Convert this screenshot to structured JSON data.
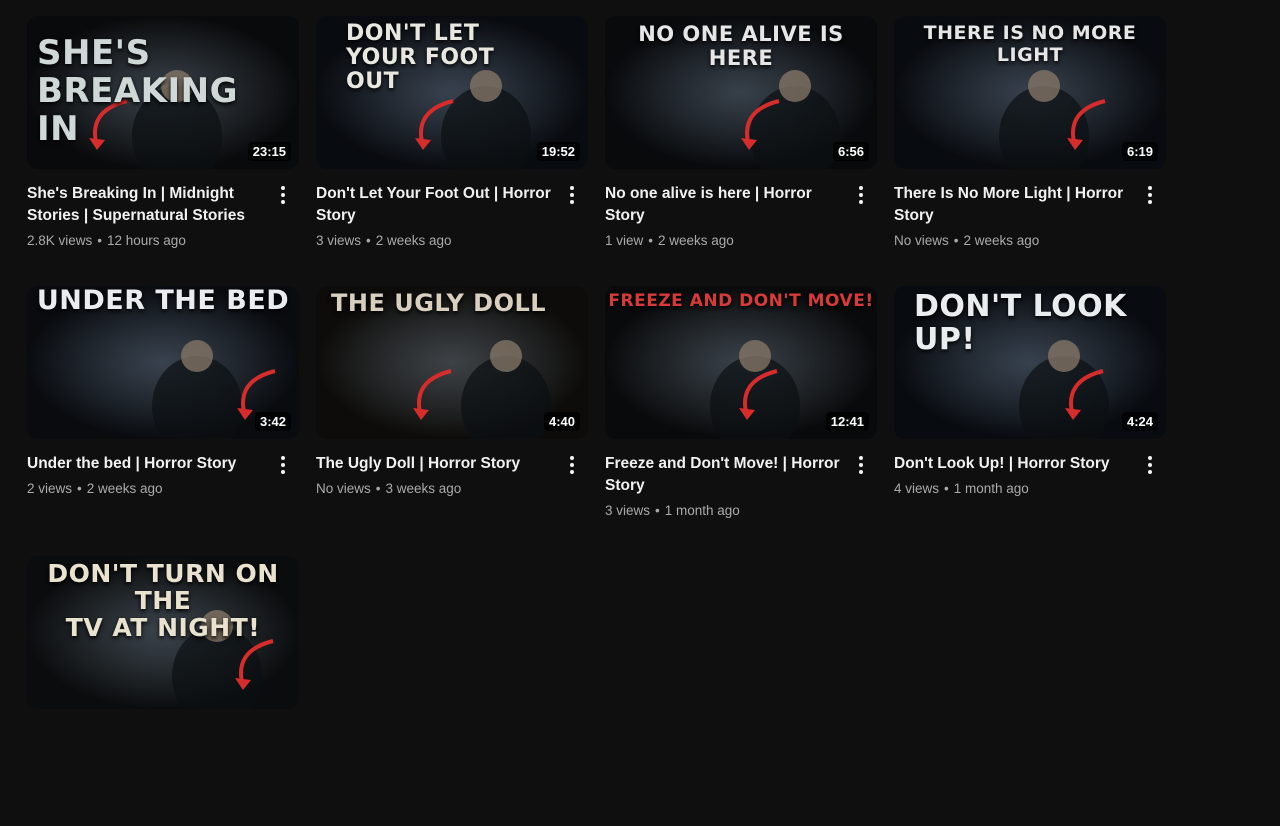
{
  "videos": [
    {
      "thumb_text": "SHE'S BREAKING IN",
      "duration": "23:15",
      "title": "She's Breaking In | Midnight Stories | Supernatural Stories",
      "views": "2.8K views",
      "age": "12 hours ago",
      "bg": "#1e2226"
    },
    {
      "thumb_text": "DON'T LET YOUR FOOT OUT",
      "duration": "19:52",
      "title": "Don't Let Your Foot Out | Horror Story",
      "views": "3 views",
      "age": "2 weeks ago",
      "bg": "#1c2433"
    },
    {
      "thumb_text": "NO ONE ALIVE IS HERE",
      "duration": "6:56",
      "title": "No one alive is here | Horror Story",
      "views": "1 view",
      "age": "2 weeks ago",
      "bg": "#1a2028"
    },
    {
      "thumb_text": "THERE IS NO MORE LIGHT",
      "duration": "6:19",
      "title": "There Is No More Light | Horror Story",
      "views": "No views",
      "age": "2 weeks ago",
      "bg": "#1b2331"
    },
    {
      "thumb_text": "UNDER THE BED",
      "duration": "3:42",
      "title": "Under the bed | Horror Story",
      "views": "2 views",
      "age": "2 weeks ago",
      "bg": "#1d2532"
    },
    {
      "thumb_text": "THE UGLY DOLL",
      "duration": "4:40",
      "title": "The Ugly Doll | Horror Story",
      "views": "No views",
      "age": "3 weeks ago",
      "bg": "#2a2620"
    },
    {
      "thumb_text": "FREEZE AND DON'T MOVE!",
      "duration": "12:41",
      "title": "Freeze and Don't Move! | Horror Story",
      "views": "3 views",
      "age": "1 month ago",
      "bg": "#1e2124"
    },
    {
      "thumb_text": "DON'T LOOK UP!",
      "duration": "4:24",
      "title": "Don't Look Up! | Horror Story",
      "views": "4 views",
      "age": "1 month ago",
      "bg": "#1a2433"
    },
    {
      "thumb_text": "DON'T TURN ON THE TV AT NIGHT!",
      "duration": "",
      "title": "",
      "views": "",
      "age": "",
      "bg": "#23282b"
    }
  ],
  "separator": "•"
}
